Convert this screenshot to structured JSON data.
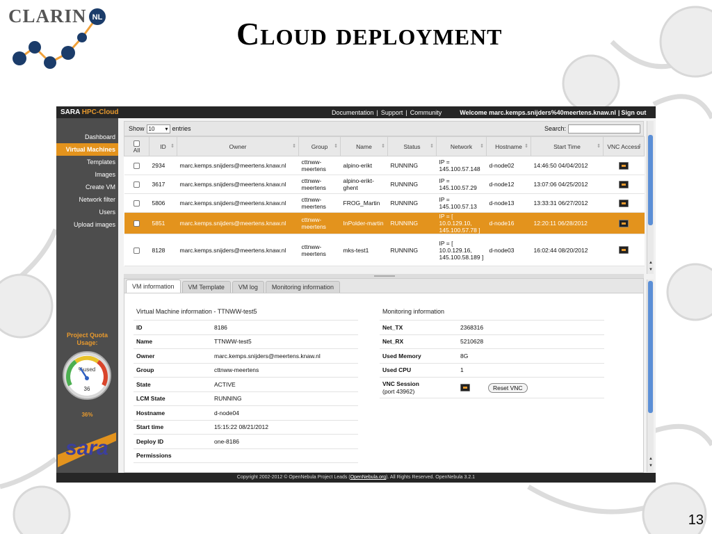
{
  "slide": {
    "title": "Cloud deployment",
    "page_number": "13",
    "logo_text": "CLARIN",
    "logo_badge": "NL"
  },
  "app": {
    "brand_main": "SARA",
    "brand_accent": "HPC-Cloud",
    "top_links": [
      "Documentation",
      "|",
      "Support",
      "|",
      "Community"
    ],
    "welcome": "Welcome marc.kemps.snijders%40meertens.knaw.nl",
    "separator": "|",
    "sign_out": "Sign out"
  },
  "sidebar": {
    "items": [
      {
        "label": "Dashboard",
        "active": false
      },
      {
        "label": "Virtual Machines",
        "active": true
      },
      {
        "label": "Templates",
        "active": false
      },
      {
        "label": "Images",
        "active": false
      },
      {
        "label": "Create VM",
        "active": false
      },
      {
        "label": "Network filter",
        "active": false
      },
      {
        "label": "Users",
        "active": false
      },
      {
        "label": "Upload images",
        "active": false
      }
    ],
    "quota_title": "Project Quota Usage:",
    "gauge_label": "%used",
    "gauge_value": "36",
    "quota_percent": "36%",
    "quota_fraction": 0.36,
    "sara_logo_text": "sara"
  },
  "table": {
    "show_label": "Show",
    "entries_count": "10",
    "entries_label": "entries",
    "search_label": "Search:",
    "search_value": "",
    "columns": [
      "All",
      "ID",
      "Owner",
      "Group",
      "Name",
      "Status",
      "Network",
      "Hostname",
      "Start Time",
      "VNC Access"
    ],
    "rows": [
      {
        "id": "2934",
        "owner": "marc.kemps.snijders@meertens.knaw.nl",
        "group": "cttnww-meertens",
        "name": "alpino-erikt",
        "status": "RUNNING",
        "network": "IP = 145.100.57.148",
        "hostname": "d-node02",
        "start": "14:46:50 04/04/2012",
        "selected": false,
        "big": false
      },
      {
        "id": "3617",
        "owner": "marc.kemps.snijders@meertens.knaw.nl",
        "group": "cttnww-meertens",
        "name": "alpino-erikt-ghent",
        "status": "RUNNING",
        "network": "IP = 145.100.57.29",
        "hostname": "d-node12",
        "start": "13:07:06 04/25/2012",
        "selected": false,
        "big": false
      },
      {
        "id": "5806",
        "owner": "marc.kemps.snijders@meertens.knaw.nl",
        "group": "cttnww-meertens",
        "name": "FROG_Martin",
        "status": "RUNNING",
        "network": "IP = 145.100.57.13",
        "hostname": "d-node13",
        "start": "13:33:31 06/27/2012",
        "selected": false,
        "big": false
      },
      {
        "id": "5851",
        "owner": "marc.kemps.snijders@meertens.knaw.nl",
        "group": "cttnww-meertens",
        "name": "InPolder-martin",
        "status": "RUNNING",
        "network": "IP = [ 10.0.129.10, 145.100.57.78 ]",
        "hostname": "d-node16",
        "start": "12:20:11 06/28/2012",
        "selected": true,
        "big": false
      },
      {
        "id": "8128",
        "owner": "marc.kemps.snijders@meertens.knaw.nl",
        "group": "cttnww-meertens",
        "name": "mks-test1",
        "status": "RUNNING",
        "network": "IP = [ 10.0.129.16, 145.100.58.189 ]",
        "hostname": "d-node03",
        "start": "16:02:44 08/20/2012",
        "selected": false,
        "big": true
      }
    ]
  },
  "info": {
    "tabs": [
      "VM information",
      "VM Template",
      "VM log",
      "Monitoring information"
    ],
    "vm_title": "Virtual Machine information - TTNWW-test5",
    "vm_fields": [
      {
        "key": "ID",
        "value": "8186"
      },
      {
        "key": "Name",
        "value": "TTNWW-test5"
      },
      {
        "key": "Owner",
        "value": "marc.kemps.snijders@meertens.knaw.nl"
      },
      {
        "key": "Group",
        "value": "cttnww-meertens"
      },
      {
        "key": "State",
        "value": "ACTIVE"
      },
      {
        "key": "LCM State",
        "value": "RUNNING"
      },
      {
        "key": "Hostname",
        "value": "d-node04"
      },
      {
        "key": "Start time",
        "value": "15:15:22 08/21/2012"
      },
      {
        "key": "Deploy ID",
        "value": "one-8186"
      },
      {
        "key": "Permissions",
        "value": ""
      }
    ],
    "mon_title": "Monitoring information",
    "mon_fields": [
      {
        "key": "Net_TX",
        "value": "2368316"
      },
      {
        "key": "Net_RX",
        "value": "5210628"
      },
      {
        "key": "Used Memory",
        "value": "8G"
      },
      {
        "key": "Used CPU",
        "value": "1"
      }
    ],
    "vnc_key": "VNC Session",
    "vnc_port": "(port 43962)",
    "reset_vnc": "Reset VNC"
  },
  "footer": {
    "pre": "Copyright 2002-2012 © OpenNebula Project Leads (",
    "link": "OpenNebula.org",
    "post": "). All Rights Reserved. OpenNebula 3.2.1"
  },
  "colors": {
    "accent": "#e3931d",
    "dark_bar": "#262626",
    "sidebar": "#4d4d4d",
    "scroll_thumb": "#5b8fd6"
  }
}
